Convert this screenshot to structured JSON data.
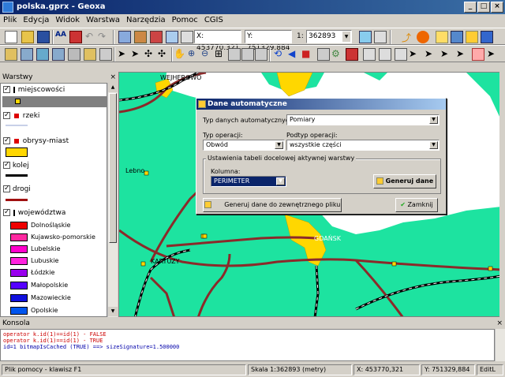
{
  "window": {
    "title": "polska.gprx - Geoxa"
  },
  "menu": [
    "Plik",
    "Edycja",
    "Widok",
    "Warstwa",
    "Narzędzia",
    "Pomoc",
    "CGIS"
  ],
  "toolbar": {
    "coord_x": "X: 453770.321",
    "coord_y": "Y: 751329.884",
    "scale_prefix": "1:",
    "scale_value": "362893"
  },
  "panel": {
    "title": "Warstwy",
    "layers": [
      {
        "label": "miejscowości"
      },
      {
        "label": "rzeki"
      },
      {
        "label": "obrysy-miast"
      },
      {
        "label": "kolej"
      },
      {
        "label": "drogi"
      },
      {
        "label": "województwa"
      }
    ],
    "regions": [
      {
        "label": "Dolnośląskie",
        "color": "#ee0000"
      },
      {
        "label": "Kujawsko-pomorskie",
        "color": "#ff2aa0"
      },
      {
        "label": "Lubelskie",
        "color": "#ff00cc"
      },
      {
        "label": "Lubuskie",
        "color": "#ff22dd"
      },
      {
        "label": "Łódzkie",
        "color": "#9900ee"
      },
      {
        "label": "Małopolskie",
        "color": "#5500ff"
      },
      {
        "label": "Mazowieckie",
        "color": "#1111dd"
      },
      {
        "label": "Opolskie",
        "color": "#0055ee"
      }
    ]
  },
  "map": {
    "labels": [
      "WEJHEROWO",
      "Lebno",
      "KARTUZY",
      "GDAŃSK"
    ],
    "colors": {
      "land": "#1de3a0",
      "road": "#8b2a2a",
      "rail": "#000000",
      "city": "#ffd700"
    }
  },
  "dialog": {
    "title": "Dane automatyczne",
    "type_label": "Typ danych automatycznych:",
    "type_value": "Pomiary",
    "op_label": "Typ operacji:",
    "op_value": "Obwód",
    "subop_label": "Podtyp operacji:",
    "subop_value": "wszystkie części",
    "group_label": "Ustawienia tabeli docelowej aktywnej warstwy",
    "column_label": "Kolumna:",
    "column_value": "PERIMETER",
    "generate_button": "Generuj dane",
    "external_button": "Generuj dane do zewnętrznego pliku",
    "close_button": "Zamknij"
  },
  "console": {
    "title": "Konsola",
    "lines": [
      {
        "text": "operator k.id(1)==id(1) - FALSE",
        "color": "#cc0000"
      },
      {
        "text": "operator k.id(1)==id(1) - TRUE",
        "color": "#cc0000"
      },
      {
        "text": "  id=1 bitmapIsCached (TRUE) ==> sizeSignature=1.500000",
        "color": "#0000aa"
      }
    ]
  },
  "status": {
    "help": "Plik pomocy - klawisz F1",
    "scale": "Skala 1:362893 (metry)",
    "x": "X: 453770,321",
    "y": "Y: 751329,884",
    "mode": "EditL"
  }
}
